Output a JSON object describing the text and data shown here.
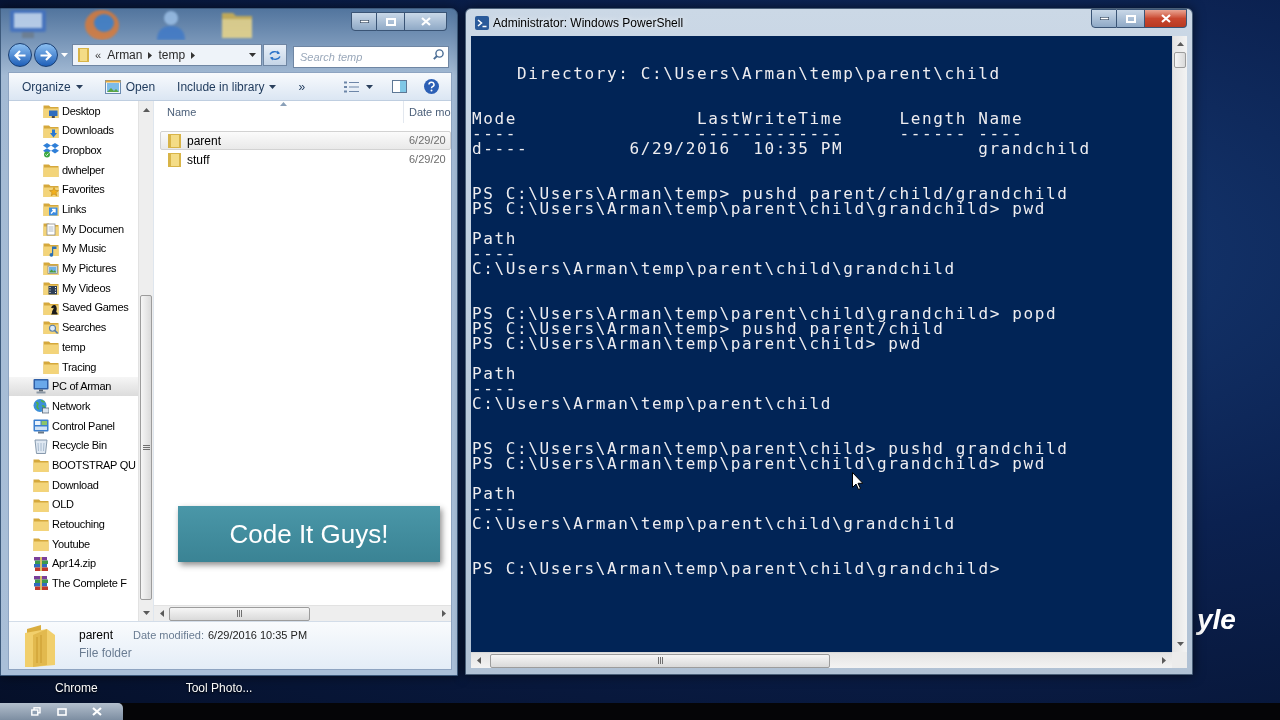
{
  "desktop": {
    "shortcuts": [
      {
        "label": "Chrome"
      },
      {
        "label": "Tool Photo..."
      }
    ],
    "wallpaper_text": "yle"
  },
  "explorer": {
    "address": {
      "overflow": "«",
      "crumbs": [
        "Arman",
        "temp"
      ]
    },
    "search": {
      "placeholder": "Search temp"
    },
    "toolbar": [
      {
        "label": "Organize",
        "kind": "dropdown"
      },
      {
        "label": "Open",
        "kind": "icon"
      },
      {
        "label": "Include in library",
        "kind": "dropdown"
      },
      {
        "label": "»",
        "kind": "overflow"
      }
    ],
    "nav_tree": [
      {
        "children": [
          {
            "label": "Desktop",
            "kind": "desktop",
            "selected": false
          },
          {
            "label": "Downloads",
            "kind": "downloads",
            "selected": false
          },
          {
            "label": "Dropbox",
            "kind": "dropbox",
            "selected": false
          },
          {
            "label": "dwhelper",
            "kind": "folder",
            "selected": false
          },
          {
            "label": "Favorites",
            "kind": "favorites",
            "selected": false
          },
          {
            "label": "Links",
            "kind": "links",
            "selected": false
          },
          {
            "label": "My Documen",
            "kind": "documents",
            "selected": false
          },
          {
            "label": "My Music",
            "kind": "music",
            "selected": false
          },
          {
            "label": "My Pictures",
            "kind": "pictures",
            "selected": false
          },
          {
            "label": "My Videos",
            "kind": "videos",
            "selected": false
          },
          {
            "label": "Saved Games",
            "kind": "games",
            "selected": false
          },
          {
            "label": "Searches",
            "kind": "searches",
            "selected": false
          },
          {
            "label": "temp",
            "kind": "folder",
            "selected": false
          },
          {
            "label": "Tracing",
            "kind": "folder",
            "selected": false
          }
        ]
      },
      {
        "label": "PC of Arman",
        "kind": "computer",
        "selected": true
      },
      {
        "label": "Network",
        "kind": "network",
        "selected": false
      },
      {
        "label": "Control Panel",
        "kind": "controlpanel",
        "selected": false
      },
      {
        "label": "Recycle Bin",
        "kind": "recyclebin",
        "selected": false
      },
      {
        "label": "BOOTSTRAP QU",
        "kind": "folder",
        "selected": false
      },
      {
        "label": "Download",
        "kind": "folder",
        "selected": false
      },
      {
        "label": "OLD",
        "kind": "folder",
        "selected": false
      },
      {
        "label": "Retouching",
        "kind": "folder",
        "selected": false
      },
      {
        "label": "Youtube",
        "kind": "folder",
        "selected": false
      },
      {
        "label": "Apr14.zip",
        "kind": "archive",
        "selected": false
      },
      {
        "label": "The Complete F",
        "kind": "archive",
        "selected": false
      }
    ],
    "columns": [
      "Name",
      "Date mo"
    ],
    "files": [
      {
        "name": "parent",
        "date": "6/29/20",
        "selected": true
      },
      {
        "name": "stuff",
        "date": "6/29/20",
        "selected": false
      }
    ],
    "details": {
      "name": "parent",
      "type": "File folder",
      "date_label": "Date modified:",
      "date": "6/29/2016 10:35 PM"
    }
  },
  "banner": {
    "text": "Code It Guys!"
  },
  "powershell": {
    "title": "Administrator: Windows PowerShell",
    "blocks": [
      {
        "kind": "heading",
        "lines": [
          "Directory: C:\\Users\\Arman\\temp\\parent\\child"
        ]
      },
      {
        "kind": "listing",
        "columns": [
          {
            "header": "Mode",
            "rule": "----"
          },
          {
            "header": "LastWriteTime",
            "rule": "-------------"
          },
          {
            "header": "Length",
            "rule": "------"
          },
          {
            "header": "Name",
            "rule": "----"
          }
        ],
        "rows": [
          {
            "mode": "d----",
            "last_write_time": "6/29/2016  10:35 PM",
            "name": "grandchild"
          }
        ]
      },
      {
        "kind": "commands",
        "lines": [
          "PS C:\\Users\\Arman\\temp> pushd parent/child/grandchild",
          "PS C:\\Users\\Arman\\temp\\parent\\child\\grandchild> pwd"
        ]
      },
      {
        "kind": "output",
        "lines": [
          "Path",
          "----",
          "C:\\Users\\Arman\\temp\\parent\\child\\grandchild"
        ]
      },
      {
        "kind": "commands",
        "lines": [
          "PS C:\\Users\\Arman\\temp\\parent\\child\\grandchild> popd",
          "PS C:\\Users\\Arman\\temp> pushd parent/child",
          "PS C:\\Users\\Arman\\temp\\parent\\child> pwd"
        ]
      },
      {
        "kind": "output",
        "lines": [
          "Path",
          "----",
          "C:\\Users\\Arman\\temp\\parent\\child"
        ]
      },
      {
        "kind": "commands",
        "lines": [
          "PS C:\\Users\\Arman\\temp\\parent\\child> pushd grandchild",
          "PS C:\\Users\\Arman\\temp\\parent\\child\\grandchild> pwd"
        ]
      },
      {
        "kind": "output",
        "lines": [
          "Path",
          "----",
          "C:\\Users\\Arman\\temp\\parent\\child\\grandchild"
        ]
      },
      {
        "kind": "commands",
        "lines": [
          "PS C:\\Users\\Arman\\temp\\parent\\child\\grandchild>"
        ]
      }
    ]
  }
}
